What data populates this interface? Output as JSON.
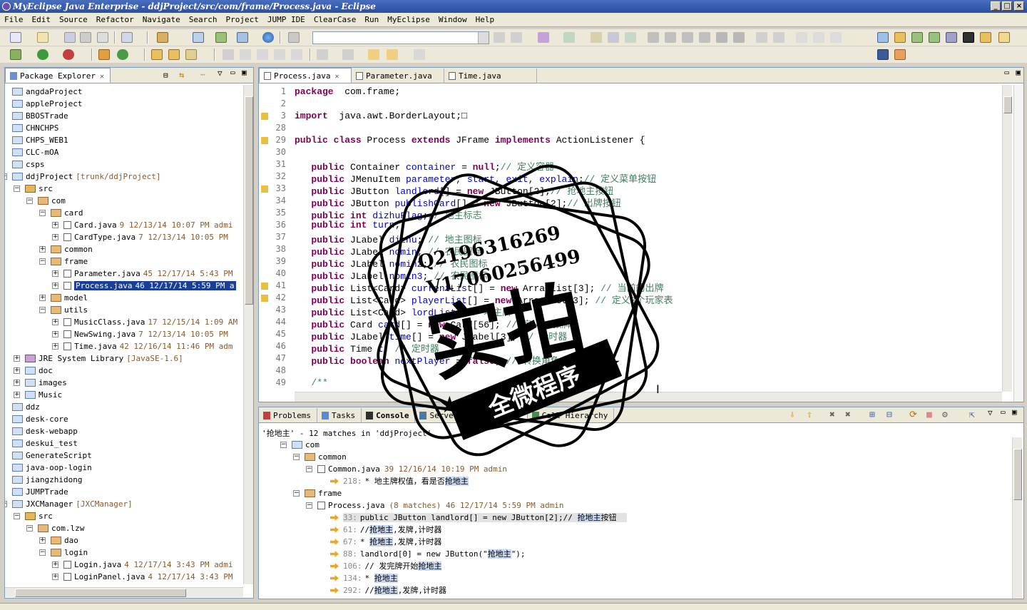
{
  "window": {
    "title": "MyEclipse Java Enterprise - ddjProject/src/com/frame/Process.java - Eclipse",
    "controls": [
      "_",
      "□",
      "×"
    ]
  },
  "menubar": [
    "File",
    "Edit",
    "Source",
    "Refactor",
    "Navigate",
    "Search",
    "Project",
    "JUMP IDE",
    "ClearCase",
    "Run",
    "MyEclipse",
    "Window",
    "Help"
  ],
  "package_explorer": {
    "title": "Package Explorer",
    "items": [
      {
        "label": "angdaProject",
        "deco": ""
      },
      {
        "label": "appleProject",
        "deco": ""
      },
      {
        "label": "BBOSTrade",
        "deco": ""
      },
      {
        "label": "CHNCHPS",
        "deco": ""
      },
      {
        "label": "CHPS_WEB1",
        "deco": ""
      },
      {
        "label": "CLC-mOA",
        "deco": ""
      },
      {
        "label": "csps",
        "deco": ""
      },
      {
        "label": "ddjProject",
        "deco": "[trunk/ddjProject]"
      },
      {
        "label": "src",
        "deco": ""
      },
      {
        "label": "com",
        "deco": ""
      },
      {
        "label": "card",
        "deco": ""
      },
      {
        "label": "Card.java",
        "deco": "9  12/13/14 10:07 PM  admi"
      },
      {
        "label": "CardType.java",
        "deco": "7  12/13/14 10:05 PM"
      },
      {
        "label": "common",
        "deco": ""
      },
      {
        "label": "frame",
        "deco": ""
      },
      {
        "label": "Parameter.java",
        "deco": "45  12/17/14 5:43 PM"
      },
      {
        "label": "Process.java",
        "deco": "46  12/17/14 5:59 PM  a"
      },
      {
        "label": "model",
        "deco": ""
      },
      {
        "label": "utils",
        "deco": ""
      },
      {
        "label": "MusicClass.java",
        "deco": "17  12/15/14 1:09 AM"
      },
      {
        "label": "NewSwing.java",
        "deco": "7  12/13/14 10:05 PM"
      },
      {
        "label": "Time.java",
        "deco": "42  12/16/14 11:46 PM  adm"
      },
      {
        "label": "JRE System Library",
        "deco": "[JavaSE-1.6]"
      },
      {
        "label": "doc",
        "deco": ""
      },
      {
        "label": "images",
        "deco": ""
      },
      {
        "label": "Music",
        "deco": ""
      },
      {
        "label": "ddz",
        "deco": ""
      },
      {
        "label": "desk-core",
        "deco": ""
      },
      {
        "label": "desk-webapp",
        "deco": ""
      },
      {
        "label": "deskui_test",
        "deco": ""
      },
      {
        "label": "GenerateScript",
        "deco": ""
      },
      {
        "label": "java-oop-login",
        "deco": ""
      },
      {
        "label": "jiangzhidong",
        "deco": ""
      },
      {
        "label": "JUMPTrade",
        "deco": ""
      },
      {
        "label": "JXCManager",
        "deco": "[JXCManager]"
      },
      {
        "label": "src",
        "deco": ""
      },
      {
        "label": "com.lzw",
        "deco": ""
      },
      {
        "label": "dao",
        "deco": ""
      },
      {
        "label": "login",
        "deco": ""
      },
      {
        "label": "Login.java",
        "deco": "4  12/17/14 3:43 PM  admi"
      },
      {
        "label": "LoginPanel.java",
        "deco": "4  12/17/14 3:43 PM"
      }
    ]
  },
  "editor": {
    "tabs": [
      {
        "label": "Process.java",
        "active": true
      },
      {
        "label": "Parameter.java",
        "active": false
      },
      {
        "label": "Time.java",
        "active": false
      }
    ],
    "lines": [
      {
        "n": "1",
        "code": [
          [
            "kw",
            "package"
          ],
          [
            "",
            "  com.frame;"
          ]
        ]
      },
      {
        "n": "2",
        "code": []
      },
      {
        "n": "3",
        "code": [
          [
            "kw",
            "import"
          ],
          [
            "",
            "  java.awt.BorderLayout;"
          ],
          [
            "",
            "□"
          ]
        ]
      },
      {
        "n": "28",
        "code": []
      },
      {
        "n": "29",
        "code": [
          [
            "kw",
            "public class"
          ],
          [
            "",
            " Process "
          ],
          [
            "kw",
            "extends"
          ],
          [
            "",
            " JFrame "
          ],
          [
            "kw",
            "implements"
          ],
          [
            "",
            " ActionListener {"
          ]
        ]
      },
      {
        "n": "30",
        "code": []
      },
      {
        "n": "31",
        "code": [
          [
            "",
            "   "
          ],
          [
            "kw",
            "public"
          ],
          [
            "",
            " Container "
          ],
          [
            "fld",
            "container"
          ],
          [
            "",
            " = "
          ],
          [
            "kw",
            "null"
          ],
          [
            "",
            ";"
          ],
          [
            "cm",
            "// 定义容器"
          ]
        ]
      },
      {
        "n": "32",
        "code": [
          [
            "",
            "   "
          ],
          [
            "kw",
            "public"
          ],
          [
            "",
            " JMenuItem "
          ],
          [
            "fld",
            "parameter, start, exit, explain"
          ],
          [
            "",
            ";"
          ],
          [
            "cm",
            "// 定义菜单按钮"
          ]
        ]
      },
      {
        "n": "33",
        "code": [
          [
            "",
            "   "
          ],
          [
            "kw",
            "public"
          ],
          [
            "",
            " JButton "
          ],
          [
            "fld",
            "landlord"
          ],
          [
            "",
            "[] = "
          ],
          [
            "kw",
            "new"
          ],
          [
            "",
            " JButton[2];"
          ],
          [
            "cm",
            "// 抢地主按钮"
          ]
        ]
      },
      {
        "n": "34",
        "code": [
          [
            "",
            "   "
          ],
          [
            "kw",
            "public"
          ],
          [
            "",
            " JButton "
          ],
          [
            "fld",
            "publishCard"
          ],
          [
            "",
            "[] = "
          ],
          [
            "kw",
            "new"
          ],
          [
            "",
            " JButton[2];"
          ],
          [
            "cm",
            "// 出牌按钮"
          ]
        ]
      },
      {
        "n": "35",
        "code": [
          [
            "",
            "   "
          ],
          [
            "kw",
            "public int"
          ],
          [
            "",
            " "
          ],
          [
            "fld",
            "dizhuFlag"
          ],
          [
            "",
            ";"
          ],
          [
            "cm",
            "// 地主标志"
          ]
        ]
      },
      {
        "n": "36",
        "code": [
          [
            "",
            "   "
          ],
          [
            "kw",
            "public int"
          ],
          [
            "",
            " "
          ],
          [
            "fld",
            "turn"
          ],
          [
            "",
            ";"
          ]
        ]
      },
      {
        "n": "37",
        "code": [
          [
            "",
            "   "
          ],
          [
            "kw",
            "public"
          ],
          [
            "",
            " JLabel "
          ],
          [
            "fld",
            "dizhu"
          ],
          [
            "",
            "; "
          ],
          [
            "cm",
            "// 地主图标"
          ]
        ]
      },
      {
        "n": "38",
        "code": [
          [
            "",
            "   "
          ],
          [
            "kw",
            "public"
          ],
          [
            "",
            " JLabel "
          ],
          [
            "fld",
            "nomin"
          ],
          [
            "",
            "; "
          ],
          [
            "cm",
            "// 农民图标"
          ]
        ]
      },
      {
        "n": "39",
        "code": [
          [
            "",
            "   "
          ],
          [
            "kw",
            "public"
          ],
          [
            "",
            " JLabel "
          ],
          [
            "fld",
            "nomin2"
          ],
          [
            "",
            "; "
          ],
          [
            "cm",
            "// 农民图标"
          ]
        ]
      },
      {
        "n": "40",
        "code": [
          [
            "",
            "   "
          ],
          [
            "kw",
            "public"
          ],
          [
            "",
            " JLabel "
          ],
          [
            "fld",
            "nomin3"
          ],
          [
            "",
            "; "
          ],
          [
            "cm",
            "// 农民图标"
          ]
        ]
      },
      {
        "n": "41",
        "code": [
          [
            "",
            "   "
          ],
          [
            "kw",
            "public"
          ],
          [
            "",
            " List<Card> "
          ],
          [
            "fld",
            "currentList"
          ],
          [
            "",
            "[] = "
          ],
          [
            "kw",
            "new"
          ],
          [
            "",
            " ArrayList[3]; "
          ],
          [
            "cm",
            "// 当前的出牌"
          ]
        ]
      },
      {
        "n": "42",
        "code": [
          [
            "",
            "   "
          ],
          [
            "kw",
            "public"
          ],
          [
            "",
            " List<Card> "
          ],
          [
            "fld",
            "playerList"
          ],
          [
            "",
            "[] = "
          ],
          [
            "kw",
            "new"
          ],
          [
            "",
            " ArrayList[3]; "
          ],
          [
            "cm",
            "// 定义3个玩家表"
          ]
        ]
      },
      {
        "n": "43",
        "code": [
          [
            "",
            "   "
          ],
          [
            "kw",
            "public"
          ],
          [
            "",
            " List<Card> "
          ],
          [
            "fld",
            "lordList"
          ],
          [
            "",
            "; "
          ],
          [
            "cm",
            "// 地主牌"
          ]
        ]
      },
      {
        "n": "44",
        "code": [
          [
            "",
            "   "
          ],
          [
            "kw",
            "public"
          ],
          [
            "",
            " Card "
          ],
          [
            "fld",
            "card"
          ],
          [
            "",
            "[] = "
          ],
          [
            "kw",
            "new"
          ],
          [
            "",
            " Card[56]; "
          ],
          [
            "cm",
            "// 定义54张牌"
          ]
        ]
      },
      {
        "n": "45",
        "code": [
          [
            "",
            "   "
          ],
          [
            "kw",
            "public"
          ],
          [
            "",
            " JLabel "
          ],
          [
            "fld",
            "time"
          ],
          [
            "",
            "[] = "
          ],
          [
            "kw",
            "new"
          ],
          [
            "",
            " JLabel[3]; "
          ],
          [
            "cm",
            "// 计时器"
          ]
        ]
      },
      {
        "n": "46",
        "code": [
          [
            "",
            "   "
          ],
          [
            "kw",
            "public"
          ],
          [
            "",
            " Time "
          ],
          [
            "fld",
            "t"
          ],
          [
            "",
            "; "
          ],
          [
            "cm",
            "// 定时器"
          ]
        ]
      },
      {
        "n": "47",
        "code": [
          [
            "",
            "   "
          ],
          [
            "kw",
            "public boolean"
          ],
          [
            "",
            " "
          ],
          [
            "fld",
            "nextPlayer"
          ],
          [
            "",
            " = "
          ],
          [
            "kw",
            "false"
          ],
          [
            "",
            "; "
          ],
          [
            "cm",
            "// 转换角色"
          ]
        ]
      },
      {
        "n": "48",
        "code": []
      },
      {
        "n": "49",
        "code": [
          [
            "",
            "   "
          ],
          [
            "cm",
            "/**"
          ]
        ]
      }
    ]
  },
  "bottom_panel": {
    "tabs": [
      "Problems",
      "Tasks",
      "Console",
      "Servers",
      "Search",
      "Call Hierarchy"
    ],
    "active_tab": "Search",
    "summary": "'抢地主' - 12 matches in 'ddjProject'",
    "results": [
      {
        "indent": 0,
        "kind": "pkg",
        "text": "com"
      },
      {
        "indent": 1,
        "kind": "folder",
        "text": "common"
      },
      {
        "indent": 2,
        "kind": "file",
        "text": "Common.java",
        "deco": "39  12/16/14 10:19 PM  admin"
      },
      {
        "indent": 3,
        "kind": "match",
        "line": "218:",
        "text": "* 地主牌权值，看是否",
        "hit": "抢地主",
        "after": ""
      },
      {
        "indent": 1,
        "kind": "folder",
        "text": "frame"
      },
      {
        "indent": 2,
        "kind": "file",
        "text": "Process.java",
        "deco": "(8 matches)  46  12/17/14 5:59 PM  admin"
      },
      {
        "indent": 3,
        "kind": "match",
        "line": "33:",
        "text": "public JButton landlord[] = new JButton[2];// ",
        "hit": "抢地主",
        "after": "按钮",
        "selected": true
      },
      {
        "indent": 3,
        "kind": "match",
        "line": "61:",
        "text": "//",
        "hit": "抢地主",
        "after": ",发牌,计时器"
      },
      {
        "indent": 3,
        "kind": "match",
        "line": "67:",
        "text": "* ",
        "hit": "抢地主",
        "after": ",发牌,计时器"
      },
      {
        "indent": 3,
        "kind": "match",
        "line": "88:",
        "text": "landlord[0] = new JButton(\"",
        "hit": "抢地主",
        "after": "\");"
      },
      {
        "indent": 3,
        "kind": "match",
        "line": "106:",
        "text": "// 发完牌开始",
        "hit": "抢地主",
        "after": ""
      },
      {
        "indent": 3,
        "kind": "match",
        "line": "134:",
        "text": "* ",
        "hit": "抢地主",
        "after": ""
      },
      {
        "indent": 3,
        "kind": "match",
        "line": "292:",
        "text": "//",
        "hit": "抢地主",
        "after": ",发牌,计时器"
      }
    ]
  },
  "watermark": {
    "qq": "Q2196316269",
    "vx": "V17060256499",
    "main": "实拍",
    "banner": "全微程序"
  },
  "colors": {
    "keyword": "#7f0055",
    "field": "#0000c0",
    "comment": "#3f7f5f",
    "selection": "#1a3e9c",
    "title_bar": "#2a4f9e"
  }
}
